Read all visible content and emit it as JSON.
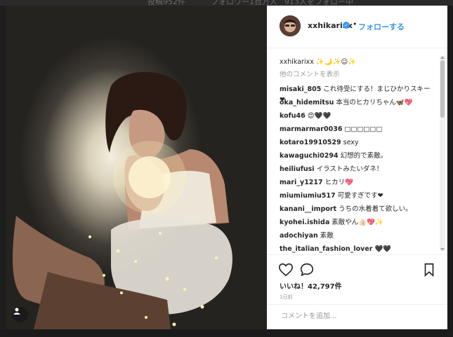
{
  "background": {
    "strip_texts": [
      "投稿952件",
      "フォロワー1百万人",
      "913人をフォロー中"
    ]
  },
  "post": {
    "username": "xxhikarixx",
    "follow_label": "フォローする",
    "caption": "xxhikarixx ✨🌙✨☺✨",
    "view_more": "他のコメントを表示",
    "comments": [
      {
        "user": "misaki_805",
        "text": "これ待受にする！まじひかりスキー❤"
      },
      {
        "user": "oka_hidemitsu",
        "text": "本当のヒカリちゃん🦋💖"
      },
      {
        "user": "kofu46",
        "text": "😍🖤🖤"
      },
      {
        "user": "marmarmar0036",
        "text": "□□□□□□"
      },
      {
        "user": "kotaro19910529",
        "text": "sexy"
      },
      {
        "user": "kawaguchi0294",
        "text": "幻想的で素敵。"
      },
      {
        "user": "heiliufusi",
        "text": "イラストみたいダネ！"
      },
      {
        "user": "mari_y1217",
        "text": "ヒカリ💖"
      },
      {
        "user": "miumiumiu517",
        "text": "可愛すぎです❤"
      },
      {
        "user": "kanani__import",
        "text": "うちの水着着て欲しい。"
      },
      {
        "user": "kyohei.ishida",
        "text": "素敵やん👍🏻💖✨"
      },
      {
        "user": "adochiyan",
        "text": "素敵"
      },
      {
        "user": "the_italian_fashion_lover",
        "text": "🖤🖤"
      }
    ],
    "likes": "いいね！42,797件",
    "time": "1日前",
    "comment_placeholder": "コメントを追加..."
  },
  "colors": {
    "link_blue": "#3897f0",
    "text": "#262626",
    "muted": "#999999"
  },
  "icons": {
    "like": "heart-icon",
    "comment": "speech-bubble-icon",
    "save": "bookmark-icon",
    "verified": "verified-badge-icon",
    "user_tag": "person-icon"
  }
}
